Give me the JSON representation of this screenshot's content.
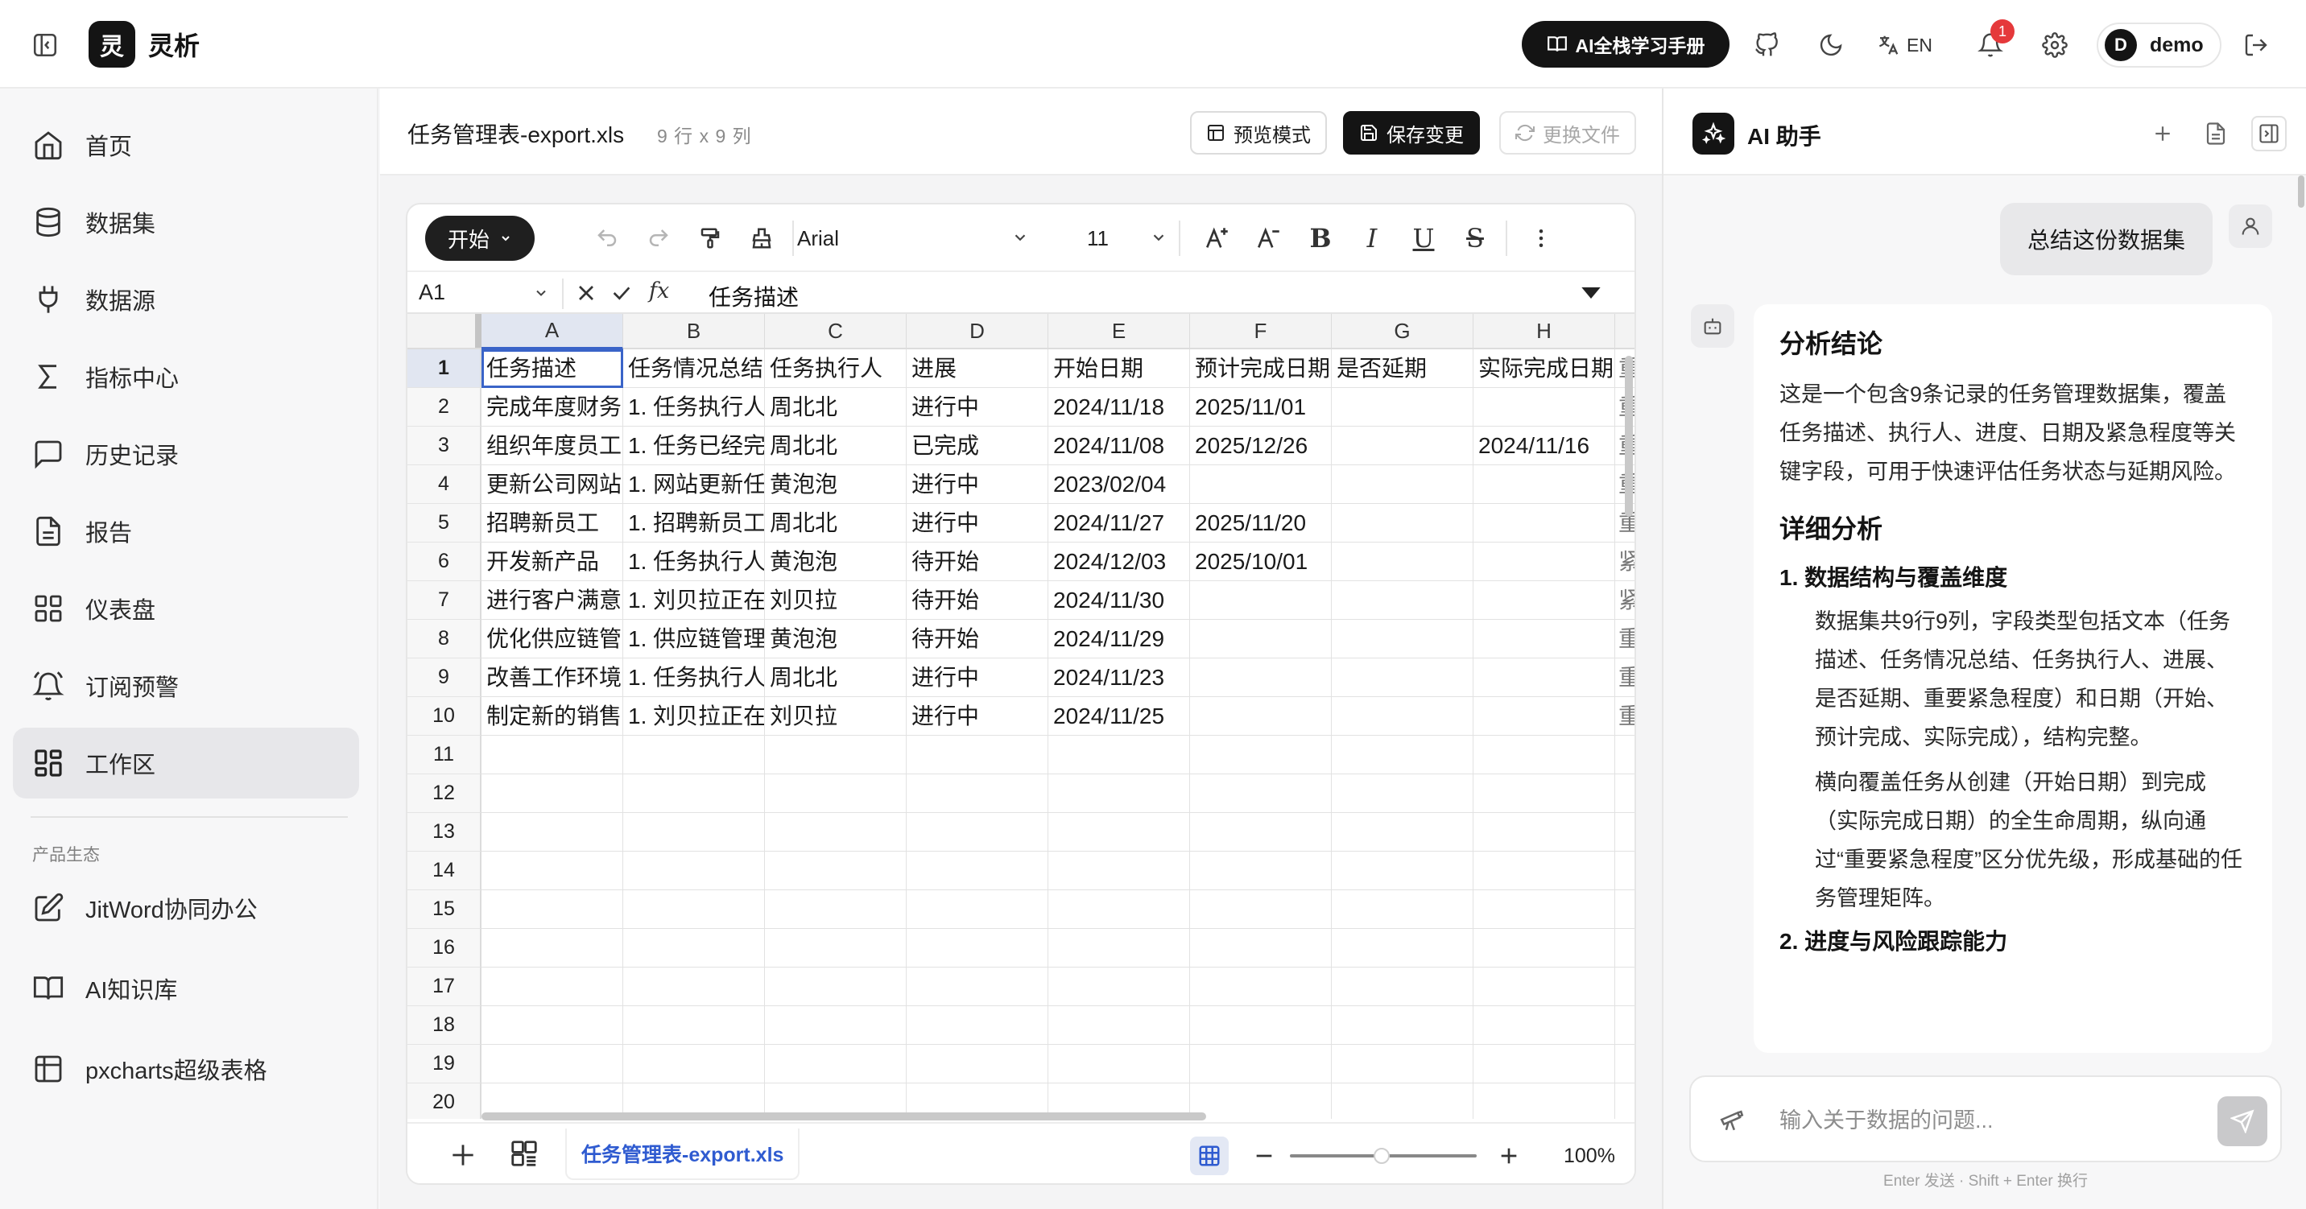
{
  "app": {
    "logo_char": "灵",
    "name": "灵析"
  },
  "topbar": {
    "guide_label": "AI全栈学习手册",
    "lang_label": "EN",
    "notification_count": "1",
    "user_initial": "D",
    "user_name": "demo"
  },
  "sidebar": {
    "items": [
      {
        "label": "首页",
        "icon": "home-icon"
      },
      {
        "label": "数据集",
        "icon": "database-icon"
      },
      {
        "label": "数据源",
        "icon": "plug-icon"
      },
      {
        "label": "指标中心",
        "icon": "sigma-icon"
      },
      {
        "label": "历史记录",
        "icon": "message-icon"
      },
      {
        "label": "报告",
        "icon": "document-icon"
      },
      {
        "label": "仪表盘",
        "icon": "dashboard-icon"
      },
      {
        "label": "订阅预警",
        "icon": "bell-alert-icon"
      },
      {
        "label": "工作区",
        "icon": "workspace-icon",
        "active": true
      }
    ],
    "section_title": "产品生态",
    "eco_items": [
      {
        "label": "JitWord协同办公",
        "icon": "edit-icon"
      },
      {
        "label": "AI知识库",
        "icon": "book-icon"
      },
      {
        "label": "pxcharts超级表格",
        "icon": "table-icon"
      }
    ]
  },
  "file": {
    "name": "任务管理表-export.xls",
    "meta": "9 行 x 9 列",
    "preview_label": "预览模式",
    "save_label": "保存变更",
    "replace_label": "更换文件"
  },
  "toolbar": {
    "start_label": "开始",
    "font": "Arial",
    "font_size": "11",
    "bold": "B",
    "italic": "I",
    "underline": "U",
    "strike": "S"
  },
  "formula_bar": {
    "cell_ref": "A1",
    "fx": "fx",
    "value": "任务描述"
  },
  "sheet": {
    "columns": [
      "A",
      "B",
      "C",
      "D",
      "E",
      "F",
      "G",
      "H"
    ],
    "active_cell": "A1",
    "rows": [
      [
        "任务描述",
        "任务情况总结",
        "任务执行人",
        "进展",
        "开始日期",
        "预计完成日期",
        "是否延期",
        "实际完成日期",
        "重"
      ],
      [
        "完成年度财务",
        "1. 任务执行人",
        "周北北",
        "进行中",
        "2024/11/18",
        "2025/11/01",
        "",
        "",
        "重"
      ],
      [
        "组织年度员工",
        "1. 任务已经完",
        "周北北",
        "已完成",
        "2024/11/08",
        "2025/12/26",
        "",
        "2024/11/16",
        "重"
      ],
      [
        "更新公司网站",
        "1. 网站更新任",
        "黄泡泡",
        "进行中",
        "2023/02/04",
        "",
        "",
        "",
        "重"
      ],
      [
        "招聘新员工",
        "1. 招聘新员工",
        "周北北",
        "进行中",
        "2024/11/27",
        "2025/11/20",
        "",
        "",
        "重"
      ],
      [
        "开发新产品",
        "1. 任务执行人",
        "黄泡泡",
        "待开始",
        "2024/12/03",
        "2025/10/01",
        "",
        "",
        "紧"
      ],
      [
        "进行客户满意",
        "1. 刘贝拉正在",
        "刘贝拉",
        "待开始",
        "2024/11/30",
        "",
        "",
        "",
        "紧"
      ],
      [
        "优化供应链管",
        "1. 供应链管理",
        "黄泡泡",
        "待开始",
        "2024/11/29",
        "",
        "",
        "",
        "重"
      ],
      [
        "改善工作环境",
        "1. 任务执行人",
        "周北北",
        "进行中",
        "2024/11/23",
        "",
        "",
        "",
        "重"
      ],
      [
        "制定新的销售",
        "1. 刘贝拉正在",
        "刘贝拉",
        "进行中",
        "2024/11/25",
        "",
        "",
        "",
        "重"
      ]
    ],
    "total_visible_rows": 20,
    "tab_name": "任务管理表-export.xls",
    "zoom": "100%"
  },
  "ai": {
    "title": "AI 助手",
    "user_message": "总结这份数据集",
    "answer": {
      "h1": "分析结论",
      "p1": "这是一个包含9条记录的任务管理数据集，覆盖任务描述、执行人、进度、日期及紧急程度等关键字段，可用于快速评估任务状态与延期风险。",
      "h2": "详细分析",
      "s1_title": "1. 数据结构与覆盖维度",
      "s1_items": [
        "数据集共9行9列，字段类型包括文本（任务描述、任务情况总结、任务执行人、进展、是否延期、重要紧急程度）和日期（开始、预计完成、实际完成），结构完整。",
        "横向覆盖任务从创建（开始日期）到完成（实际完成日期）的全生命周期，纵向通过“重要紧急程度”区分优先级，形成基础的任务管理矩阵。"
      ],
      "s2_title": "2. 进度与风险跟踪能力"
    },
    "input_placeholder": "输入关于数据的问题...",
    "hint": "Enter 发送 · Shift + Enter 换行"
  },
  "colors": {
    "accent": "#2f5bd0",
    "selection": "#3a64c8",
    "badge": "#e5393b",
    "dark": "#141414"
  }
}
